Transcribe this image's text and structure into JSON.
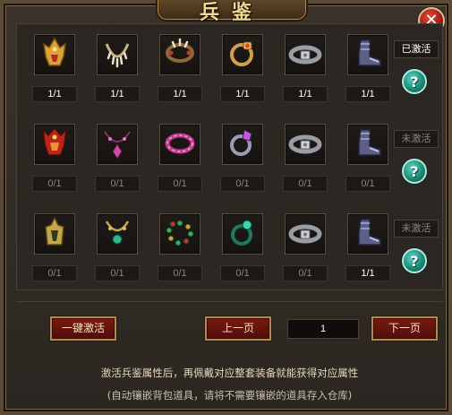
{
  "window": {
    "title": "兵鉴",
    "close_icon": "close-icon"
  },
  "rows": [
    {
      "items": [
        {
          "icon": "gold-helmet-icon",
          "count": "1/1",
          "activated": true
        },
        {
          "icon": "bone-necklace-icon",
          "count": "1/1",
          "activated": true
        },
        {
          "icon": "fang-bracelet-icon",
          "count": "1/1",
          "activated": true
        },
        {
          "icon": "gold-ring-icon",
          "count": "1/1",
          "activated": true
        },
        {
          "icon": "silver-belt-icon",
          "count": "1/1",
          "activated": true
        },
        {
          "icon": "dragon-boots-icon",
          "count": "1/1",
          "activated": true
        }
      ],
      "status": "已激活",
      "status_active": true
    },
    {
      "items": [
        {
          "icon": "red-helmet-icon",
          "count": "0/1",
          "activated": false
        },
        {
          "icon": "crystal-necklace-icon",
          "count": "0/1",
          "activated": false
        },
        {
          "icon": "pink-bracelet-icon",
          "count": "0/1",
          "activated": false
        },
        {
          "icon": "crystal-ring-icon",
          "count": "0/1",
          "activated": false
        },
        {
          "icon": "silver-belt-icon",
          "count": "0/1",
          "activated": false
        },
        {
          "icon": "dragon-boots-icon",
          "count": "0/1",
          "activated": false
        }
      ],
      "status": "未激活",
      "status_active": false
    },
    {
      "items": [
        {
          "icon": "jade-helmet-icon",
          "count": "0/1",
          "activated": false
        },
        {
          "icon": "jade-necklace-icon",
          "count": "0/1",
          "activated": false
        },
        {
          "icon": "bead-bracelet-icon",
          "count": "0/1",
          "activated": false
        },
        {
          "icon": "jade-ring-icon",
          "count": "0/1",
          "activated": false
        },
        {
          "icon": "silver-belt-icon",
          "count": "0/1",
          "activated": false
        },
        {
          "icon": "dragon-boots-icon",
          "count": "1/1",
          "activated": true
        }
      ],
      "status": "未激活",
      "status_active": false
    }
  ],
  "help_icon": "help-icon",
  "help_label": "?",
  "buttons": {
    "one_click": "一键激活",
    "prev": "上一页",
    "next": "下一页"
  },
  "page": "1",
  "tips": {
    "line1": "激活兵鉴属性后，再佩戴对应整套装备就能获得对应属性",
    "line2": "(自动镶嵌背包道具，请将不需要镶嵌的道具存入仓库)"
  },
  "colors": {
    "activated_text": "#ffffff",
    "inactive_text": "#8a857e",
    "button_red": "#7a1a12",
    "help_teal": "#1d8c7a"
  }
}
